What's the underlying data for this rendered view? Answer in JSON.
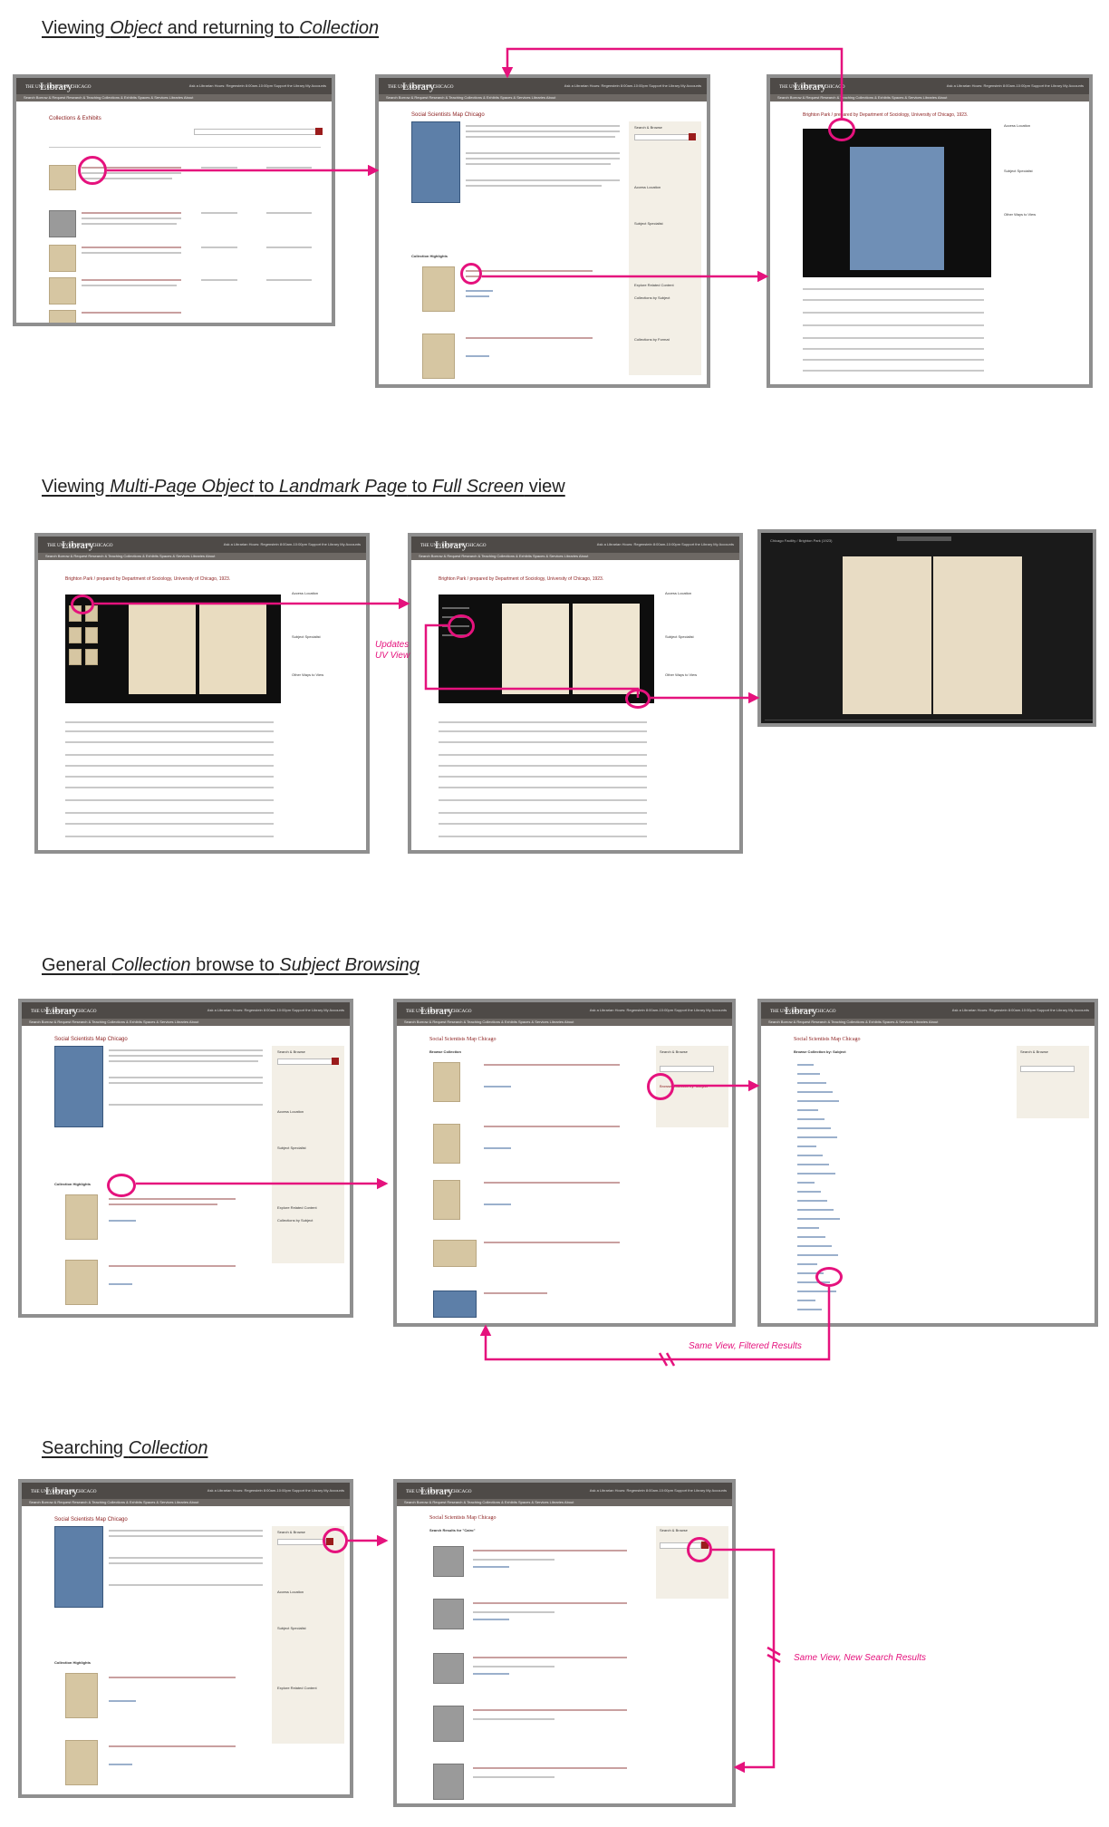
{
  "sections": [
    {
      "title_plain_1": "Viewing ",
      "title_italic_1": "Object",
      "title_plain_2": " and returning to ",
      "title_italic_2": "Collection"
    },
    {
      "title_plain_1": "Viewing ",
      "title_italic_1": "Multi-Page Object",
      "title_plain_2": " to ",
      "title_italic_2": "Landmark Page",
      "title_plain_3": " to ",
      "title_italic_3": "Full Screen",
      "title_plain_4": " view"
    },
    {
      "title_plain_1": "General ",
      "title_italic_1": "Collection",
      "title_plain_2": " browse to ",
      "title_italic_2": "Subject Browsing"
    },
    {
      "title_plain_1": "Searching ",
      "title_italic_1": "Collection"
    }
  ],
  "annotations": {
    "updates_uv_view_line1": "Updates",
    "updates_uv_view_line2": "UV View",
    "same_view_filtered": "Same View, Filtered Results",
    "same_view_new_search": "Same View, New Search Results"
  },
  "ui": {
    "logo_small": "THE UNIVERSITY OF CHICAGO",
    "logo": "Library",
    "header_links": "Ask a Librarian   Hours: Regenstein 8:00am-10:00pm   Support the Library   My Accounts",
    "nav_links": "Search   Borrow & Request   Research & Teaching   Collections & Exhibits   Spaces & Services   Libraries   About",
    "collections_exhibits": "Collections & Exhibits",
    "social_scientists_map": "Social Scientists Map Chicago",
    "brighton_park": "Brighton Park / prepared by Department of Sociology, University of Chicago, 1923.",
    "search_results_for": "Search Results for \"Cairo\"",
    "browse_collection": "Browse Collection",
    "browse_by_subject": "Browse Collection by: Subject",
    "search_and_browse": "Search & Browse",
    "collection_highlights": "Collection Highlights",
    "access_location": "Access Location",
    "subject_specialist": "Subject Specialist",
    "explore_related": "Explore Related Content",
    "collections_by_subject": "Collections by Subject",
    "collections_by_format": "Collections by Format",
    "other_ways": "Other Ways to View",
    "full_screen_bar": "Chicago Facility / Brighton Park (1923)"
  }
}
